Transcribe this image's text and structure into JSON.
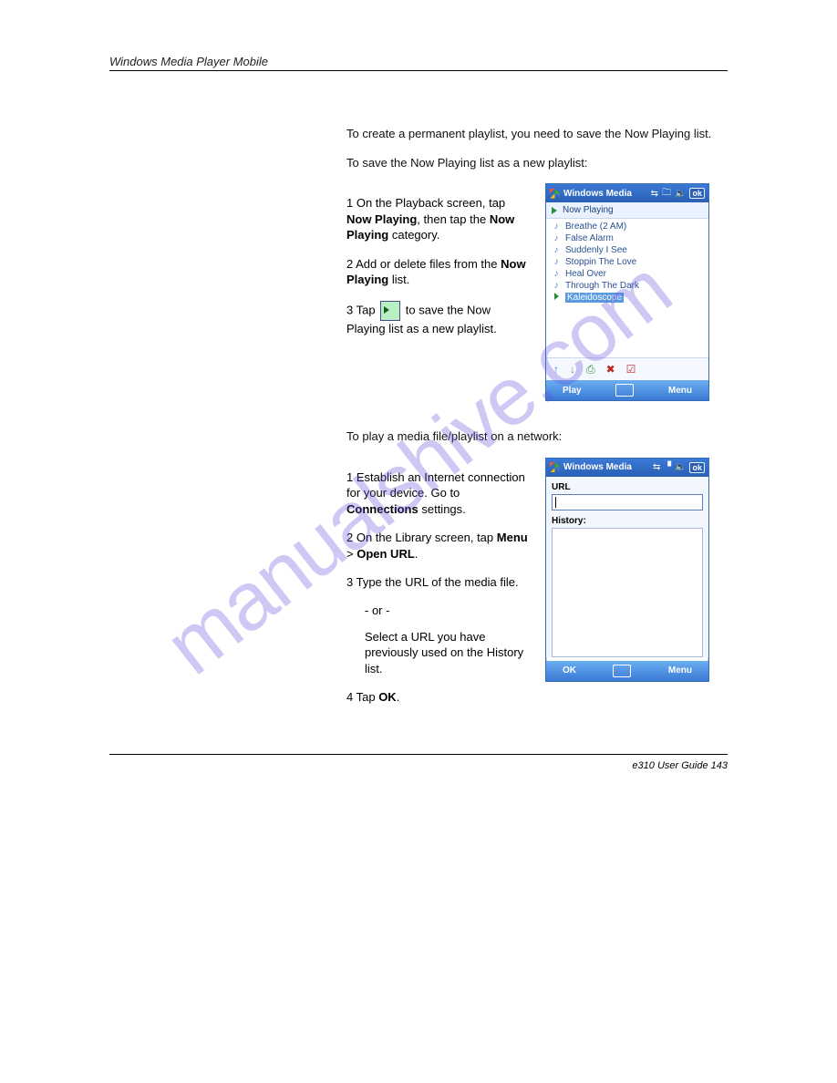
{
  "header": "Windows Media Player Mobile",
  "intro": "To create a permanent playlist, you need to save the Now Playing list.",
  "section1": {
    "heading": "To save the Now Playing list as a new playlist:",
    "step1_prefix": "1  On the Playback screen, tap ",
    "step1_boldA": "Now Playing",
    "step1_mid": ", then tap the ",
    "step1_boldB": "Now Playing ",
    "step1_mid2": "category.",
    "step2_prefix": "2  Add or delete files from the ",
    "step2_bold": "Now Playing",
    "step2_suffix": " list.",
    "step3_prefix": "3  Tap ",
    "step3_icon_note": " to save the Now Playing list as a new playlist.",
    "screenshot": {
      "title": "Windows Media",
      "ok": "ok",
      "header": "Now Playing",
      "items": [
        "Breathe (2 AM)",
        "False Alarm",
        "Suddenly I See",
        "Stoppin The Love",
        "Heal Over",
        "Through The Dark"
      ],
      "selected": "Kaleidoscope",
      "menu_left": "Play",
      "menu_right": "Menu"
    }
  },
  "section2": {
    "heading": "To play a media file/playlist on a network:",
    "step1_prefix": "1  Establish an Internet connection for your device. Go to ",
    "step1_boldA": "Connections",
    "step1_mid": " settings.",
    "step2_prefix": "2  On the Library screen, tap ",
    "step2_boldA": "Menu",
    "step2_mid": " > ",
    "step2_boldB": "Open URL",
    "step2_suffix": ".",
    "step3": "3  Type the URL of the media file.",
    "or": "- or -",
    "step3alt": "Select a URL you have previously used on the History list.",
    "step4_prefix": "4  Tap ",
    "step4_bold": "OK",
    "step4_suffix": ".",
    "screenshot": {
      "title": "Windows Media",
      "ok": "ok",
      "url_label": "URL",
      "history_label": "History:",
      "menu_left": "OK",
      "menu_right": "Menu"
    }
  },
  "footer": "e310   User Guide   143",
  "watermark": "manualshive.com"
}
